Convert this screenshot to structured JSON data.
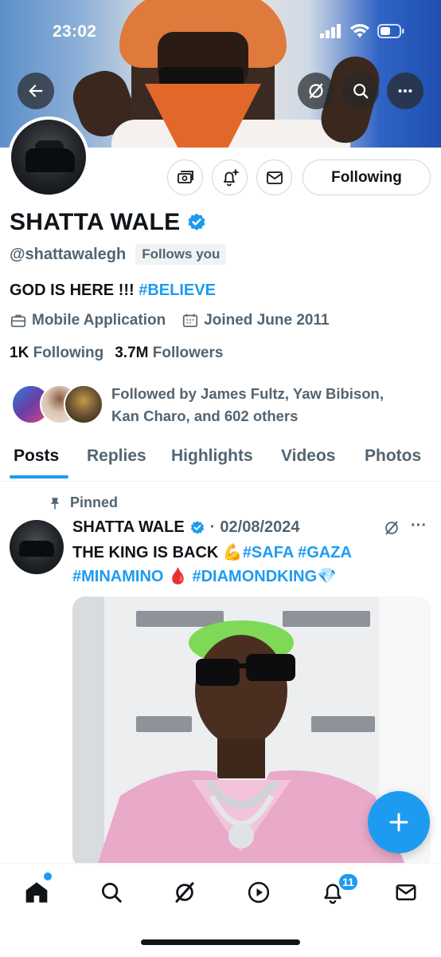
{
  "status_bar": {
    "time": "23:02"
  },
  "profile": {
    "display_name": "SHATTA WALE",
    "handle": "@shattawalegh",
    "follows_you": "Follows you",
    "bio_text": "GOD IS HERE !!!",
    "bio_tag": "#BELIEVE",
    "category": "Mobile Application",
    "joined": "Joined June 2011",
    "following_count": "1K",
    "following_label": "Following",
    "followers_count": "3.7M",
    "followers_label": "Followers",
    "followed_by": "Followed by James Fultz, Yaw Bibison, Kan Charo, and 602 others",
    "following_button": "Following"
  },
  "tabs": [
    "Posts",
    "Replies",
    "Highlights",
    "Videos",
    "Photos"
  ],
  "post": {
    "pinned_label": "Pinned",
    "author": "SHATTA WALE",
    "date_separator": "·",
    "date": "02/08/2024",
    "text_plain": "THE KING IS BACK 💪",
    "tag1": "#SAFA",
    "tag2": "#GAZA",
    "tag3": "#MINAMINO",
    "drop": "🩸",
    "tag4": "#DIAMONDKING",
    "gem": "💎",
    "more": "···"
  },
  "nav": {
    "notification_badge": "11"
  },
  "colors": {
    "accent": "#1d9bf0",
    "text_primary": "#0f1419",
    "text_secondary": "#536471"
  }
}
